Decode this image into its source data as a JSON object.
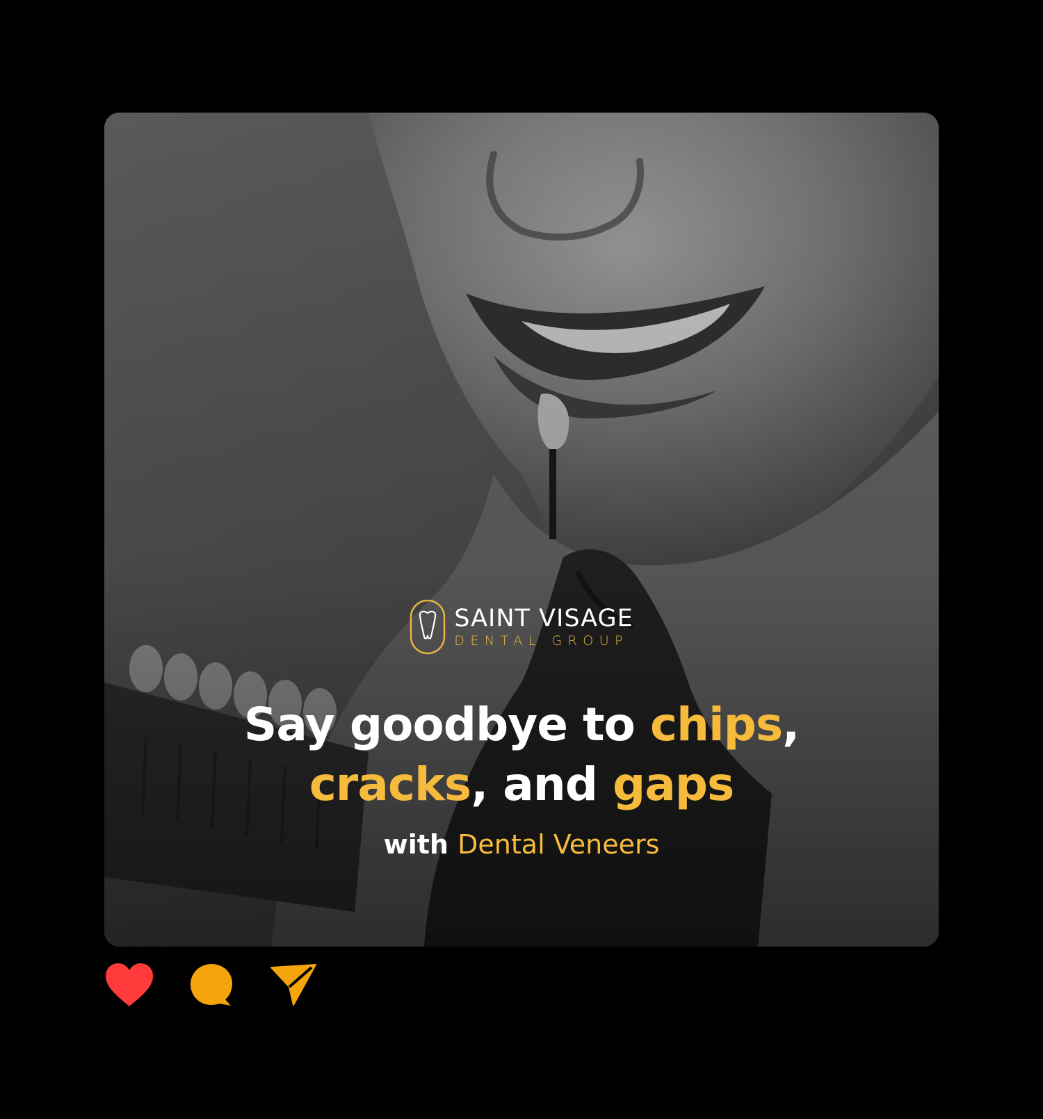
{
  "post": {
    "brand": {
      "name": "SAINT VISAGE",
      "subtitle": "DENTAL GROUP",
      "logo_icon": "tooth-icon"
    },
    "headline": {
      "part1": "Say goodbye to ",
      "highlight1": "chips",
      "part2": ",",
      "highlight2": "cracks",
      "part3": ", and ",
      "highlight3": "gaps"
    },
    "subline": {
      "prefix": "with ",
      "highlight": "Dental Veneers"
    },
    "colors": {
      "accent": "#f6bb3c",
      "like": "#ff3b3b",
      "comment": "#f5a40c",
      "share": "#f5a40c",
      "background": "#000000"
    }
  },
  "actions": {
    "like_icon": "heart-icon",
    "comment_icon": "comment-bubble-icon",
    "share_icon": "paper-plane-icon"
  }
}
